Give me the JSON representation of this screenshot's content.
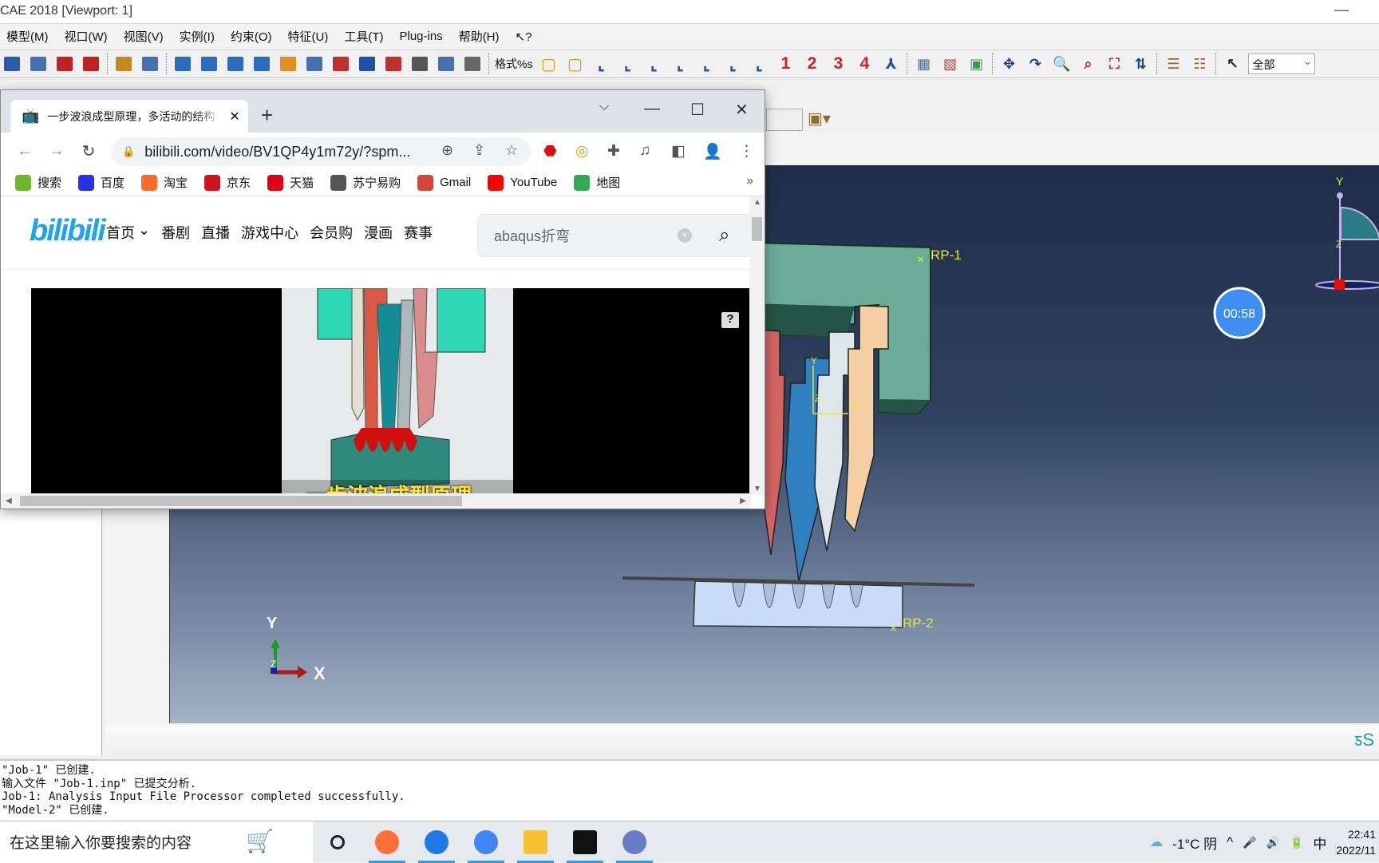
{
  "abaqus": {
    "title": "CAE 2018 [Viewport: 1]",
    "minimize": "—",
    "menu": [
      "模型(M)",
      "视口(W)",
      "视图(V)",
      "实例(I)",
      "约束(O)",
      "特征(U)",
      "工具(T)",
      "Plug-ins",
      "帮助(H)",
      "↖?"
    ],
    "toolbar": {
      "icons": [
        "save-icon",
        "print-icon",
        "import-icon",
        "export-icon",
        "datum-icon",
        "table-icon",
        "viewport-single-icon",
        "viewport-cascade-icon",
        "viewport-tile-h-icon",
        "viewport-tile-v-icon",
        "viewport-link-icon",
        "annotation-list-icon",
        "text-arrow-icon",
        "arrow-icon",
        "text-icon",
        "select-pointer-icon",
        "list-icon",
        "legend-icon"
      ],
      "format_label": "格式%s",
      "view_icons": [
        "wireframe-cube-icon",
        "shaded-cube-icon",
        "view-front-icon",
        "view-back-icon",
        "view-top-icon",
        "view-bottom-icon",
        "view-left-icon",
        "view-right-icon",
        "iso-view-icon"
      ],
      "view_numbers": [
        "1",
        "2",
        "3",
        "4"
      ],
      "render_icons": [
        "triad-rotate-icon",
        "mesh-cube-icon",
        "hidden-cube-icon",
        "filled-cube-icon",
        "pan-icon",
        "rotate-icon",
        "zoom-icon",
        "box-zoom-icon",
        "auto-fit-icon",
        "cycle-icon",
        "ladder-icon",
        "ladder-alt-icon",
        "select-arrow-icon"
      ],
      "selection_filter": "全部"
    },
    "viewport": {
      "labels": {
        "rp1": "RP-1",
        "rp2": "RP-2",
        "triad_x": "X",
        "triad_y": "Y",
        "triad_z": "Z",
        "local_x": "X",
        "local_y": "Y",
        "local_z": "Z",
        "view_y": "Y",
        "view_z": "Z"
      },
      "timer": "00:58",
      "colors": {
        "frame": "#6bab98",
        "red_punch": "#d46464",
        "blue_punch": "#2f80c0",
        "grey_punch": "#dde6ea",
        "peach_punch": "#f3cfa3",
        "die": "#c8dcf8",
        "label": "#e8e832"
      }
    },
    "messages": [
      "\"Job-1\" 已创建.",
      "输入文件 \"Job-1.inp\" 已提交分析.",
      "Job-1: Analysis Input File Processor completed successfully.",
      "\"Model-2\" 已创建."
    ]
  },
  "browser": {
    "tab_title": "一步波浪成型原理，多活动的结构",
    "url": "bilibili.com/video/BV1QP4y1m72y/?spm...",
    "bookmarks": [
      {
        "label": "搜索",
        "icon": "360-search-icon",
        "color": "#6bb82c"
      },
      {
        "label": "百度",
        "icon": "baidu-paw-icon",
        "color": "#2932e1"
      },
      {
        "label": "淘宝",
        "icon": "taobao-icon",
        "color": "#ff6a2b"
      },
      {
        "label": "京东",
        "icon": "jd-icon",
        "color": "#d0121b"
      },
      {
        "label": "天猫",
        "icon": "tmall-icon",
        "color": "#e00015"
      },
      {
        "label": "苏宁易购",
        "icon": "globe-icon",
        "color": "#555555"
      },
      {
        "label": "Gmail",
        "icon": "gmail-icon",
        "color": "#d44638"
      },
      {
        "label": "YouTube",
        "icon": "youtube-icon",
        "color": "#ff0000"
      },
      {
        "label": "地图",
        "icon": "maps-icon",
        "color": "#34a853"
      }
    ],
    "more": "»",
    "site": {
      "logo": "bilibili",
      "nav": [
        "首页",
        "番剧",
        "直播",
        "游戏中心",
        "会员购",
        "漫画",
        "赛事"
      ],
      "search_value": "abaqus折弯",
      "subtitle": "一步波浪成型原理",
      "help": "?"
    }
  },
  "taskbar": {
    "search_placeholder": "在这里输入你要搜索的内容",
    "apps": [
      "cortana-icon",
      "firefox-icon",
      "kugou-icon",
      "chrome-icon",
      "file-explorer-icon",
      "terminal-icon",
      "abaqus-icon"
    ],
    "weather": "-1°C 阴",
    "tray": [
      "^",
      "🎤",
      "🔊",
      "🔋"
    ],
    "ime": "中",
    "time": "22:41",
    "date": "2022/11"
  }
}
